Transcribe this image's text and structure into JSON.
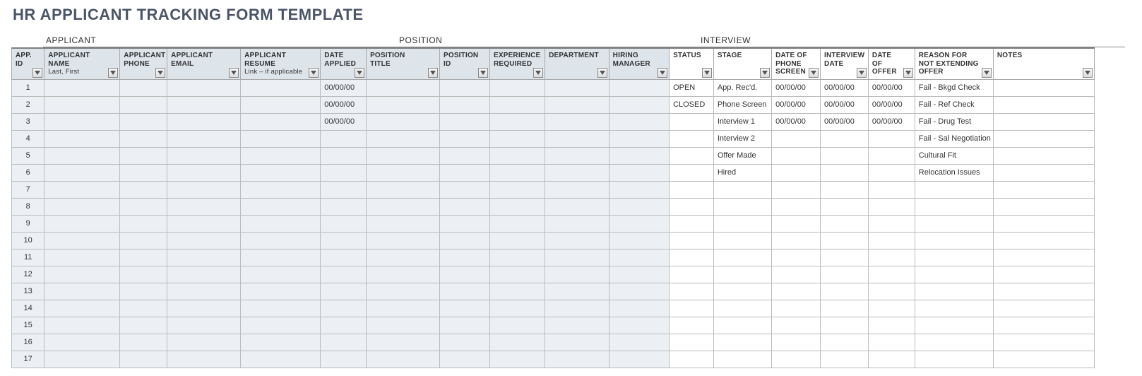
{
  "title": "HR APPLICANT TRACKING FORM TEMPLATE",
  "sections": {
    "applicant": "APPLICANT",
    "position": "POSITION",
    "interview": "INTERVIEW"
  },
  "headers": {
    "app_id": "APP. ID",
    "name": "APPLICANT NAME",
    "name_sub": "Last, First",
    "phone": "APPLICANT PHONE",
    "email": "APPLICANT EMAIL",
    "resume": "APPLICANT RESUME",
    "resume_sub": "Link – if applicable",
    "date_applied": "DATE APPLIED",
    "position_title": "POSITION TITLE",
    "position_id": "POSITION ID",
    "experience": "EXPERIENCE REQUIRED",
    "department": "DEPARTMENT",
    "hiring_manager": "HIRING MANAGER",
    "status": "STATUS",
    "stage": "STAGE",
    "dps": "DATE OF PHONE SCREEN",
    "interview_date": "INTERVIEW DATE",
    "date_offer": "DATE OF OFFER",
    "reason": "REASON FOR NOT EXTENDING OFFER",
    "notes": "NOTES"
  },
  "rows": [
    {
      "id": "1",
      "date_applied": "00/00/00",
      "status": "OPEN",
      "stage": "App. Rec'd.",
      "dps": "00/00/00",
      "idt": "00/00/00",
      "dof": "00/00/00",
      "reason": "Fail - Bkgd Check"
    },
    {
      "id": "2",
      "date_applied": "00/00/00",
      "status": "CLOSED",
      "stage": "Phone Screen",
      "dps": "00/00/00",
      "idt": "00/00/00",
      "dof": "00/00/00",
      "reason": "Fail - Ref Check"
    },
    {
      "id": "3",
      "date_applied": "00/00/00",
      "status": "",
      "stage": "Interview 1",
      "dps": "00/00/00",
      "idt": "00/00/00",
      "dof": "00/00/00",
      "reason": "Fail - Drug Test"
    },
    {
      "id": "4",
      "date_applied": "",
      "status": "",
      "stage": "Interview 2",
      "dps": "",
      "idt": "",
      "dof": "",
      "reason": "Fail - Sal Negotiation"
    },
    {
      "id": "5",
      "date_applied": "",
      "status": "",
      "stage": "Offer Made",
      "dps": "",
      "idt": "",
      "dof": "",
      "reason": "Cultural Fit"
    },
    {
      "id": "6",
      "date_applied": "",
      "status": "",
      "stage": "Hired",
      "dps": "",
      "idt": "",
      "dof": "",
      "reason": "Relocation Issues"
    },
    {
      "id": "7"
    },
    {
      "id": "8"
    },
    {
      "id": "9"
    },
    {
      "id": "10"
    },
    {
      "id": "11"
    },
    {
      "id": "12"
    },
    {
      "id": "13"
    },
    {
      "id": "14"
    },
    {
      "id": "15"
    },
    {
      "id": "16"
    },
    {
      "id": "17"
    }
  ]
}
